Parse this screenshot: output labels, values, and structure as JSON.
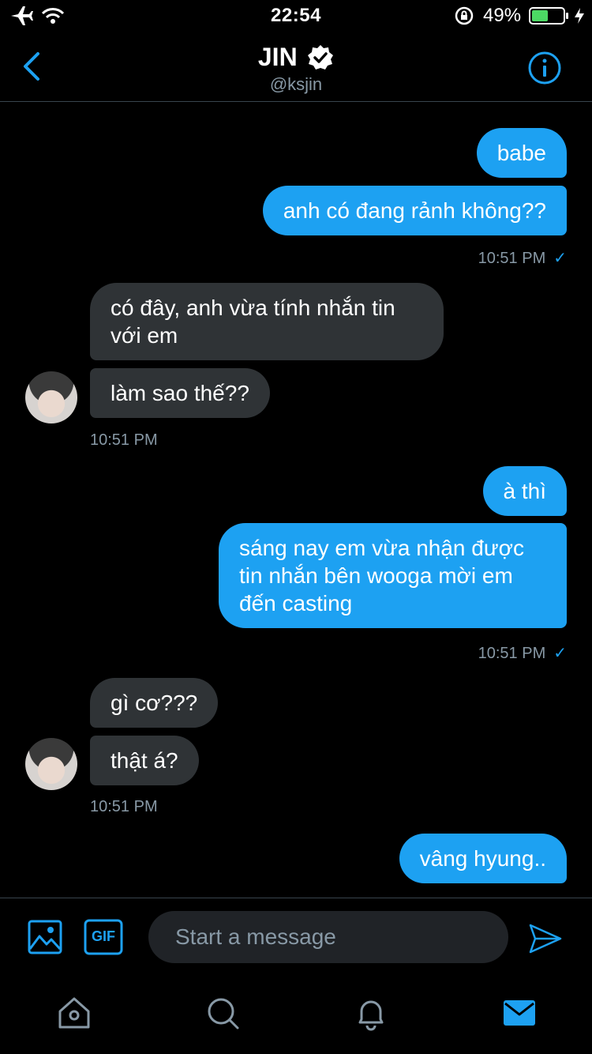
{
  "status_bar": {
    "time": "22:54",
    "battery_percent": "49%"
  },
  "header": {
    "name": "JIN",
    "handle": "@ksjin"
  },
  "messages": [
    {
      "direction": "out",
      "text": "babe"
    },
    {
      "direction": "out",
      "text": "anh có đang rảnh không??",
      "time": "10:51 PM",
      "read": true
    },
    {
      "direction": "in",
      "text": "có đây, anh vừa tính nhắn tin với em"
    },
    {
      "direction": "in",
      "text": "làm sao thế??",
      "time": "10:51 PM"
    },
    {
      "direction": "out",
      "text": "à thì"
    },
    {
      "direction": "out",
      "text": "sáng nay em vừa nhận được tin nhắn bên wooga mời em đến casting",
      "time": "10:51 PM",
      "read": true
    },
    {
      "direction": "in",
      "text": "gì cơ???"
    },
    {
      "direction": "in",
      "text": "thật á?",
      "time": "10:51 PM"
    },
    {
      "direction": "out",
      "text": "vâng hyung.."
    }
  ],
  "composer": {
    "placeholder": "Start a message",
    "gif_label": "GIF"
  },
  "tabbar": {
    "items": [
      {
        "icon": "home-icon",
        "active": false
      },
      {
        "icon": "search-icon",
        "active": false
      },
      {
        "icon": "bell-icon",
        "active": false
      },
      {
        "icon": "mail-icon",
        "active": true
      }
    ]
  },
  "colors": {
    "accent": "#1da1f2",
    "incoming_bubble": "#2f3336",
    "muted": "#8899a6",
    "background": "#000000"
  }
}
